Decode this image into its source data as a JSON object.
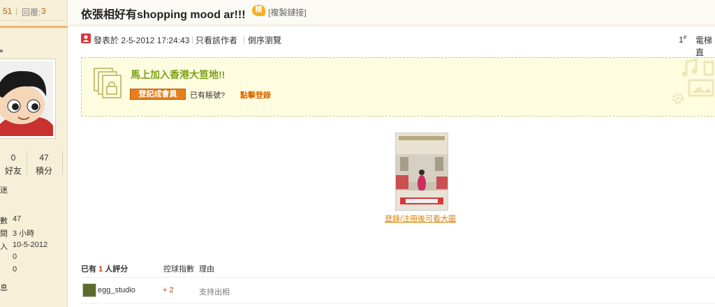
{
  "sidebar": {
    "views": "51",
    "replies_label": "回覆:",
    "replies_value": "3",
    "partial_label_top": "迷",
    "stats": [
      {
        "value": "0",
        "label": "好友"
      },
      {
        "value": "47",
        "label": "積分"
      }
    ],
    "info_rows": [
      {
        "label": "數",
        "value": "47"
      },
      {
        "label": "間",
        "value": "3 小時"
      },
      {
        "label": "入",
        "value": "10-5-2012"
      },
      {
        "label": "",
        "value": "0"
      },
      {
        "label": "",
        "value": "0"
      }
    ],
    "partial_label_bottom": "息"
  },
  "header": {
    "title": "依張相好有shopping mood ar!!!",
    "copy_link": "[複製鏈接]"
  },
  "post_meta": {
    "posted": "發表於 2-5-2012 17:24:43",
    "author_only": "只看該作者",
    "reverse": "倒序瀏覽",
    "floor": "1",
    "floor_sup": "#",
    "elevator": "電梯直"
  },
  "join_box": {
    "title": "馬上加入香港大笪地!!",
    "register_button": "登記成會員",
    "has_account": "已有賬號?",
    "login_link": "點擊登錄"
  },
  "post": {
    "image_caption": "登錄/注冊後可看大圖"
  },
  "ratings": {
    "head_prefix": "已有",
    "head_count": "1",
    "head_suffix": "人評分",
    "col_score": "控球指數",
    "col_reason": "理由",
    "rows": [
      {
        "user": "egg_studio",
        "score": "+ 2",
        "reason": "支持出相"
      }
    ]
  },
  "colors": {
    "accent_orange": "#e67f1c",
    "join_title_green": "#7ba01a",
    "sidebar_bg": "#f7f0d8"
  }
}
